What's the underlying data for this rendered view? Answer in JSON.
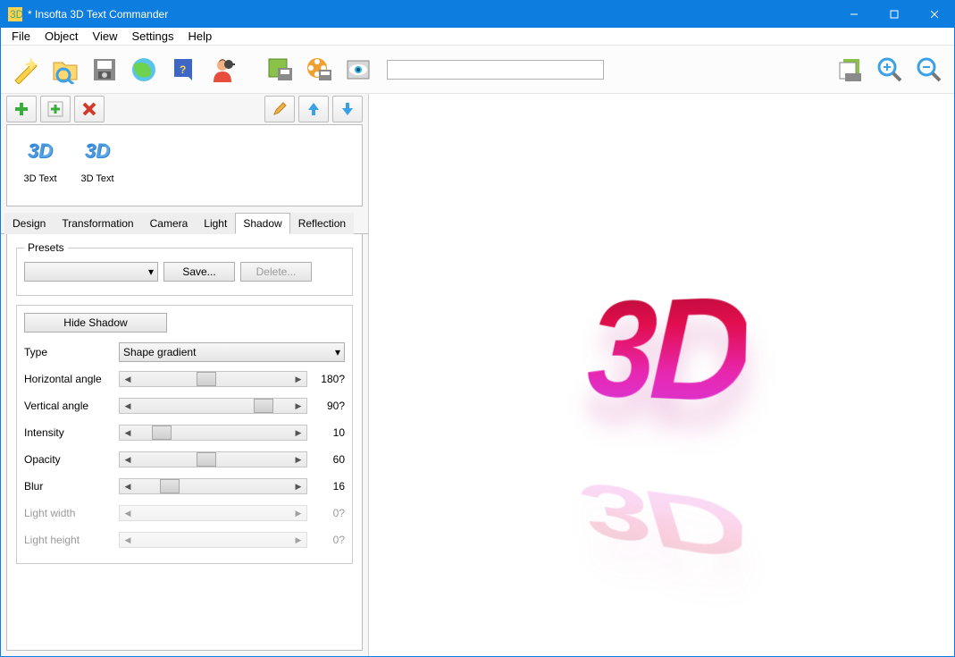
{
  "title": "* Insofta 3D Text Commander",
  "menu": [
    "File",
    "Object",
    "View",
    "Settings",
    "Help"
  ],
  "toolbar_icons": [
    "wizard-icon",
    "open-icon",
    "save-icon",
    "browser-icon",
    "help-icon",
    "user-icon",
    "export-image-icon",
    "export-movie-icon",
    "preview-icon",
    "export-layers-icon",
    "zoom-in-icon",
    "zoom-out-icon"
  ],
  "object_toolbar": {
    "add": "+",
    "add_item": "+",
    "delete": "✕",
    "edit": "✎",
    "move_up": "↑",
    "move_down": "↓"
  },
  "objects": [
    {
      "thumb": "3D",
      "label": "3D Text"
    },
    {
      "thumb": "3D",
      "label": "3D Text"
    }
  ],
  "tabs": [
    "Design",
    "Transformation",
    "Camera",
    "Light",
    "Shadow",
    "Reflection"
  ],
  "active_tab": "Shadow",
  "presets": {
    "legend": "Presets",
    "selected": "",
    "save": "Save...",
    "delete": "Delete..."
  },
  "hide_shadow_btn": "Hide Shadow",
  "type_label": "Type",
  "type_value": "Shape gradient",
  "params": [
    {
      "label": "Horizontal angle",
      "value": "180?",
      "thumb": 45,
      "disabled": false
    },
    {
      "label": "Vertical angle",
      "value": "90?",
      "thumb": 88,
      "disabled": false
    },
    {
      "label": "Intensity",
      "value": "10",
      "thumb": 12,
      "disabled": false
    },
    {
      "label": "Opacity",
      "value": "60",
      "thumb": 45,
      "disabled": false
    },
    {
      "label": "Blur",
      "value": "16",
      "thumb": 18,
      "disabled": false
    },
    {
      "label": "Light width",
      "value": "0?",
      "thumb": 0,
      "disabled": true
    },
    {
      "label": "Light height",
      "value": "0?",
      "thumb": 0,
      "disabled": true
    }
  ],
  "preview_text": "3D"
}
